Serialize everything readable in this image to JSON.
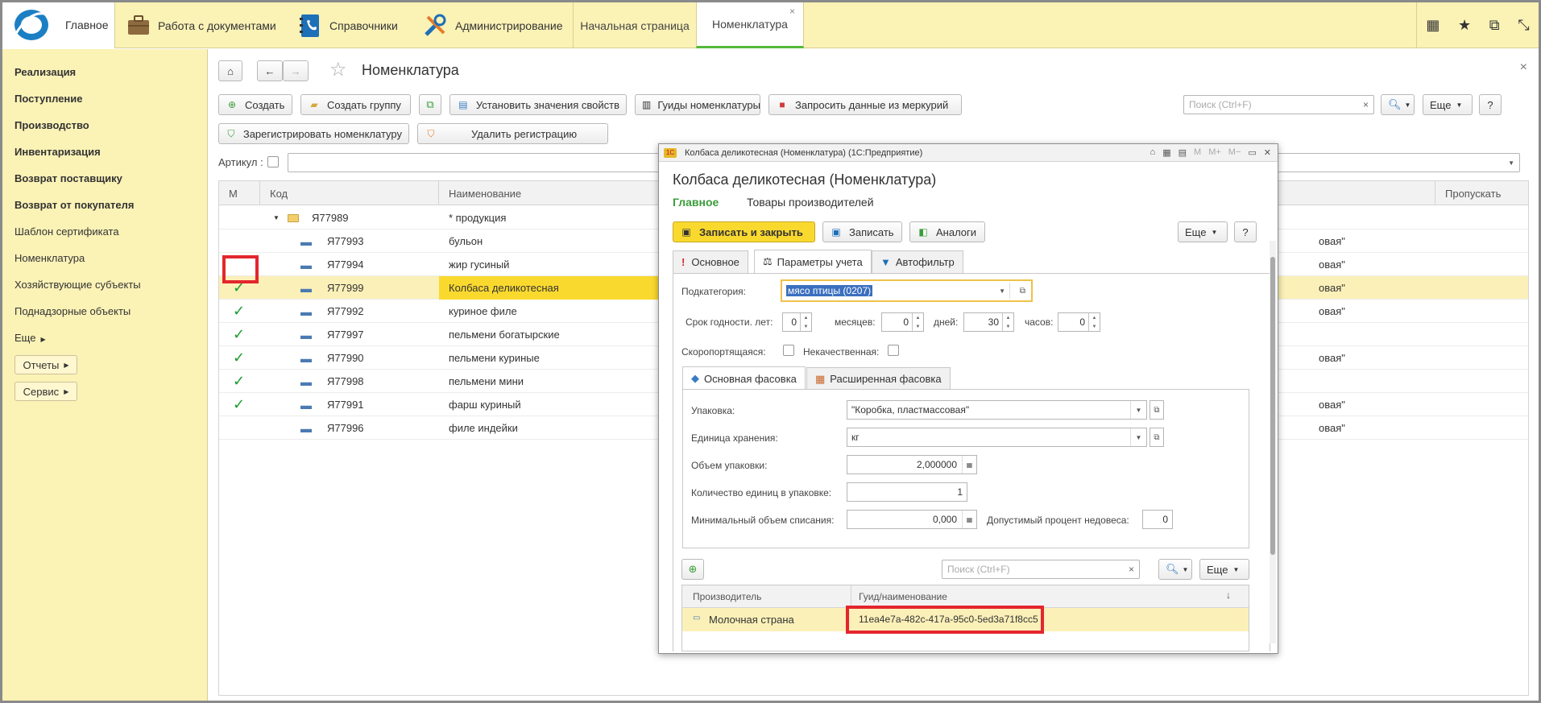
{
  "topbar": {
    "home": "Главное",
    "sections": [
      "Работа с документами",
      "Справочники",
      "Администрирование"
    ],
    "tabs": [
      "Начальная страница",
      "Номенклатура"
    ],
    "tab_close": "×"
  },
  "sidebar": {
    "items": [
      "Реализация",
      "Поступление",
      "Производство",
      "Инвентаризация",
      "Возврат поставщику",
      "Возврат от покупателя",
      "Шаблон сертификата",
      "Номенклатура",
      "Хозяйствующие субъекты",
      "Поднадзорные объекты",
      "Еще"
    ],
    "reports_btn": "Отчеты",
    "service_btn": "Сервис"
  },
  "main": {
    "title": "Номенклатура",
    "close": "×",
    "toolbar": {
      "create": "Создать",
      "create_group": "Создать группу",
      "set_props": "Установить значения свойств",
      "guids": "Гуиды номенклатуры",
      "request_mercury": "Запросить данные из меркурий",
      "register": "Зарегистрировать номенклатуру",
      "unregister": "Удалить регистрацию",
      "search_placeholder": "Поиск (Ctrl+F)",
      "more": "Еще",
      "help": "?"
    },
    "filter_label": "Артикул :",
    "table": {
      "headers": [
        "М",
        "Код",
        "Наименование",
        "Пропускать"
      ],
      "group": {
        "code": "Я77989",
        "name": "* продукция"
      },
      "rows": [
        {
          "code": "Я77993",
          "name": "бульон",
          "checked": false,
          "extra": "овая\""
        },
        {
          "code": "Я77994",
          "name": "жир гусиный",
          "checked": false,
          "extra": "овая\""
        },
        {
          "code": "Я77999",
          "name": "Колбаса деликотесная",
          "checked": true,
          "extra": "овая\""
        },
        {
          "code": "Я77992",
          "name": "куриное филе",
          "checked": true,
          "extra": "овая\""
        },
        {
          "code": "Я77997",
          "name": "пельмени богатырские",
          "checked": true,
          "extra": ""
        },
        {
          "code": "Я77990",
          "name": "пельмени куриные",
          "checked": true,
          "extra": "овая\""
        },
        {
          "code": "Я77998",
          "name": "пельмени мини",
          "checked": true,
          "extra": ""
        },
        {
          "code": "Я77991",
          "name": "фарш куриный",
          "checked": true,
          "extra": "овая\""
        },
        {
          "code": "Я77996",
          "name": "филе индейки",
          "checked": false,
          "extra": "овая\""
        }
      ]
    }
  },
  "dialog": {
    "window_title": "Колбаса деликотесная (Номенклатура)  (1С:Предприятие)",
    "title": "Колбаса деликотесная (Номенклатура)",
    "nav_main": "Главное",
    "nav_producers": "Товары производителей",
    "save_close": "Записать и закрыть",
    "save": "Записать",
    "analogs": "Аналоги",
    "more": "Еще",
    "help": "?",
    "tabs": [
      "Основное",
      "Параметры учета",
      "Автофильтр"
    ],
    "subcategory_label": "Подкатегория:",
    "subcategory_value": "мясо птицы (0207)",
    "shelf_life": {
      "years_label": "Срок годности. лет:",
      "years": "0",
      "months_label": "месяцев:",
      "months": "0",
      "days_label": "дней:",
      "days": "30",
      "hours_label": "часов:",
      "hours": "0"
    },
    "perishable_label": "Скоропортящаяся:",
    "substandard_label": "Некачественная:",
    "pack_tabs": [
      "Основная фасовка",
      "Расширенная фасовка"
    ],
    "packaging_label": "Упаковка:",
    "packaging_value": "\"Коробка, пластмассовая\"",
    "storage_unit_label": "Единица хранения:",
    "storage_unit_value": "кг",
    "pack_volume_label": "Объем упаковки:",
    "pack_volume_value": "2,000000",
    "units_in_pack_label": "Количество единиц в упаковке:",
    "units_in_pack_value": "1",
    "min_writeoff_label": "Минимальный объем списания:",
    "min_writeoff_value": "0,000",
    "underweight_label": "Допустимый процент недовеса:",
    "underweight_value": "0",
    "search_placeholder": "Поиск (Ctrl+F)",
    "producers_table": {
      "headers": [
        "Производитель",
        "Гуид/наименование"
      ],
      "sort_icon": "↓",
      "rows": [
        {
          "producer": "Молочная страна",
          "guid": "11ea4e7a-482c-417a-95c0-5ed3a71f8cc5"
        }
      ]
    }
  }
}
